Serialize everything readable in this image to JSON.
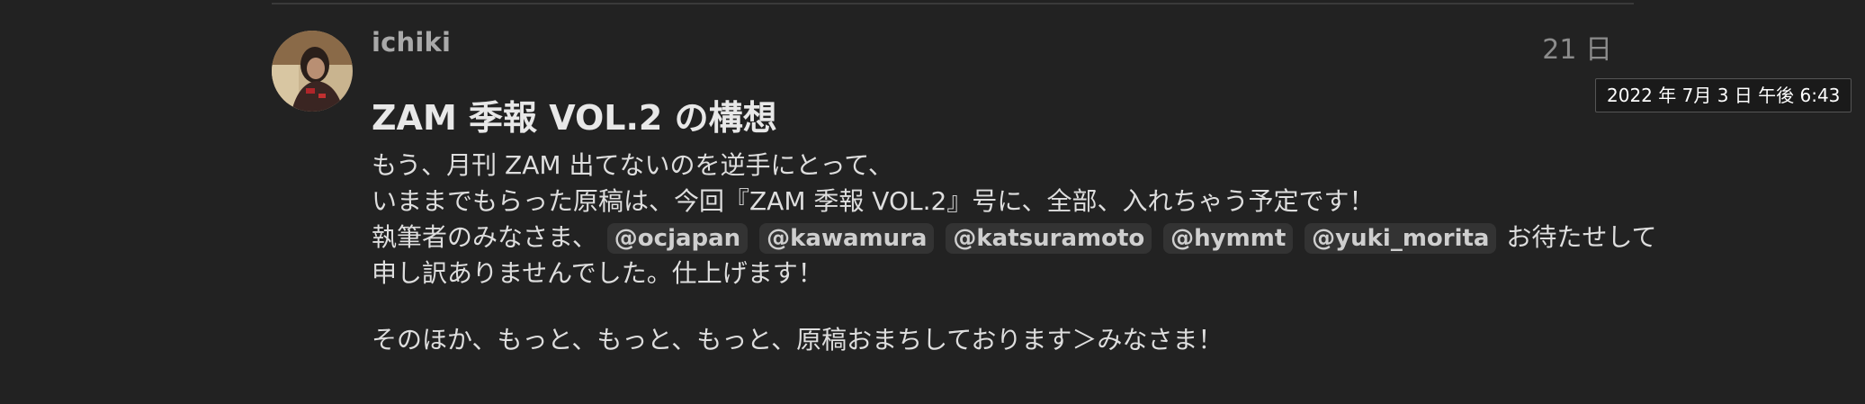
{
  "post": {
    "username": "ichiki",
    "relative_date": "21 日",
    "date_tooltip": "2022 年 7月 3 日 午後 6:43",
    "title": "ZAM 季報 VOL.2 の構想",
    "paragraph1": {
      "line1": "もう、月刊 ZAM 出てないのを逆手にとって、",
      "line2": "いままでもらった原稿は、今回『ZAM 季報 VOL.2』号に、全部、入れちゃう予定です！",
      "line3_prefix": "執筆者のみなさま、",
      "mentions": [
        "@ocjapan",
        "@kawamura",
        "@katsuramoto",
        "@hymmt",
        "@yuki_morita"
      ],
      "line3_suffix": "お待たせして",
      "line4": "申し訳ありませんでした。仕上げます！"
    },
    "paragraph2": "そのほか、もっと、もっと、もっと、原稿おまちしております＞みなさま！"
  },
  "colors": {
    "background": "#222222",
    "text": "#dedede",
    "mention_bg": "#333333",
    "muted": "#8c8c8c"
  }
}
